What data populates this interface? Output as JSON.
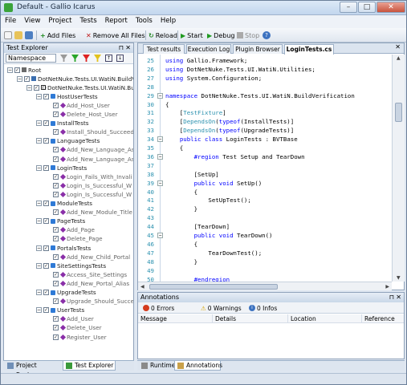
{
  "window": {
    "title": "Default - Gallio Icarus",
    "minimize": "–",
    "maximize": "□",
    "close": "✕"
  },
  "menu": [
    "File",
    "View",
    "Project",
    "Tests",
    "Report",
    "Tools",
    "Help"
  ],
  "toolbar": {
    "add_files": "Add Files",
    "remove_all_files": "Remove All Files",
    "reload": "Reload",
    "start": "Start",
    "debug": "Debug",
    "stop": "Stop"
  },
  "left_panel": {
    "title": "Test Explorer",
    "filter_value": "Namespace",
    "tree": [
      {
        "label": "Root",
        "kind": "root",
        "depth": 0
      },
      {
        "label": "DotNetNuke.Tests.UI.WatiN.BuildV",
        "kind": "asm",
        "depth": 1
      },
      {
        "label": "DotNetNuke.Tests.UI.WatiN.Buil",
        "kind": "ns",
        "depth": 2
      },
      {
        "label": "HostUserTests",
        "kind": "fix",
        "depth": 3
      },
      {
        "label": "Add_Host_User",
        "kind": "test",
        "depth": 4
      },
      {
        "label": "Delete_Host_User",
        "kind": "test",
        "depth": 4
      },
      {
        "label": "InstallTests",
        "kind": "fix",
        "depth": 3
      },
      {
        "label": "Install_Should_Succeed",
        "kind": "test",
        "depth": 4
      },
      {
        "label": "LanguageTests",
        "kind": "fix",
        "depth": 3
      },
      {
        "label": "Add_New_Language_As",
        "kind": "test",
        "depth": 4
      },
      {
        "label": "Add_New_Language_As",
        "kind": "test",
        "depth": 4
      },
      {
        "label": "LoginTests",
        "kind": "fix",
        "depth": 3
      },
      {
        "label": "Login_Fails_With_Invali",
        "kind": "test",
        "depth": 4
      },
      {
        "label": "Login_Is_Successful_W",
        "kind": "test",
        "depth": 4
      },
      {
        "label": "Login_Is_Successful_W",
        "kind": "test",
        "depth": 4
      },
      {
        "label": "ModuleTests",
        "kind": "fix",
        "depth": 3
      },
      {
        "label": "Add_New_Module_Title",
        "kind": "test",
        "depth": 4
      },
      {
        "label": "PageTests",
        "kind": "fix",
        "depth": 3
      },
      {
        "label": "Add_Page",
        "kind": "test",
        "depth": 4
      },
      {
        "label": "Delete_Page",
        "kind": "test",
        "depth": 4
      },
      {
        "label": "PortalsTests",
        "kind": "fix",
        "depth": 3
      },
      {
        "label": "Add_New_Child_Portal",
        "kind": "test",
        "depth": 4
      },
      {
        "label": "SiteSettingsTests",
        "kind": "fix",
        "depth": 3
      },
      {
        "label": "Access_Site_Settings",
        "kind": "test",
        "depth": 4
      },
      {
        "label": "Add_New_Portal_Alias",
        "kind": "test",
        "depth": 4
      },
      {
        "label": "UpgradeTests",
        "kind": "fix",
        "depth": 3
      },
      {
        "label": "Upgrade_Should_Succe",
        "kind": "test",
        "depth": 4
      },
      {
        "label": "UserTests",
        "kind": "fix",
        "depth": 3
      },
      {
        "label": "Add_User",
        "kind": "test",
        "depth": 4
      },
      {
        "label": "Delete_User",
        "kind": "test",
        "depth": 4
      },
      {
        "label": "Register_User",
        "kind": "test",
        "depth": 4
      }
    ],
    "bottom_tabs": [
      "Project Explorer",
      "Test Explorer"
    ]
  },
  "editor": {
    "tabs": [
      "Test results",
      "Execution Log",
      "Plugin Browser",
      "LoginTests.cs"
    ],
    "close": "✕",
    "lines": [
      {
        "n": "25",
        "segs": [
          {
            "t": "using ",
            "c": "kw"
          },
          {
            "t": "Gallio.Framework;",
            "c": ""
          }
        ]
      },
      {
        "n": "26",
        "segs": [
          {
            "t": "using ",
            "c": "kw"
          },
          {
            "t": "DotNetNuke.Tests.UI.WatiN.Utilities;",
            "c": ""
          }
        ]
      },
      {
        "n": "27",
        "segs": [
          {
            "t": "using ",
            "c": "kw"
          },
          {
            "t": "System.Configuration;",
            "c": ""
          }
        ]
      },
      {
        "n": "28",
        "segs": []
      },
      {
        "n": "29",
        "segs": [
          {
            "t": "namespace ",
            "c": "kw"
          },
          {
            "t": "DotNetNuke.Tests.UI.WatiN.BuildVerification",
            "c": ""
          }
        ]
      },
      {
        "n": "30",
        "segs": [
          {
            "t": "{",
            "c": ""
          }
        ]
      },
      {
        "n": "31",
        "segs": [
          {
            "t": "    [",
            "c": ""
          },
          {
            "t": "TestFixture",
            "c": "ty"
          },
          {
            "t": "]",
            "c": ""
          }
        ]
      },
      {
        "n": "32",
        "segs": [
          {
            "t": "    [",
            "c": ""
          },
          {
            "t": "DependsOn",
            "c": "ty"
          },
          {
            "t": "(",
            "c": ""
          },
          {
            "t": "typeof",
            "c": "kw"
          },
          {
            "t": "(InstallTests)]",
            "c": ""
          }
        ]
      },
      {
        "n": "33",
        "segs": [
          {
            "t": "    [",
            "c": ""
          },
          {
            "t": "DependsOn",
            "c": "ty"
          },
          {
            "t": "(",
            "c": ""
          },
          {
            "t": "typeof",
            "c": "kw"
          },
          {
            "t": "(UpgradeTests)]",
            "c": ""
          }
        ]
      },
      {
        "n": "34",
        "segs": [
          {
            "t": "    ",
            "c": ""
          },
          {
            "t": "public class ",
            "c": "kw"
          },
          {
            "t": "LoginTests : BVTBase",
            "c": ""
          }
        ]
      },
      {
        "n": "35",
        "segs": [
          {
            "t": "    {",
            "c": ""
          }
        ]
      },
      {
        "n": "36",
        "segs": [
          {
            "t": "        ",
            "c": ""
          },
          {
            "t": "#region ",
            "c": "kw"
          },
          {
            "t": "Test Setup and TearDown",
            "c": ""
          }
        ]
      },
      {
        "n": "37",
        "segs": []
      },
      {
        "n": "38",
        "segs": [
          {
            "t": "        [SetUp]",
            "c": ""
          }
        ]
      },
      {
        "n": "39",
        "segs": [
          {
            "t": "        ",
            "c": ""
          },
          {
            "t": "public void ",
            "c": "kw"
          },
          {
            "t": "SetUp()",
            "c": ""
          }
        ]
      },
      {
        "n": "40",
        "segs": [
          {
            "t": "        {",
            "c": ""
          }
        ]
      },
      {
        "n": "41",
        "segs": [
          {
            "t": "            SetUpTest();",
            "c": ""
          }
        ]
      },
      {
        "n": "42",
        "segs": [
          {
            "t": "        }",
            "c": ""
          }
        ]
      },
      {
        "n": "43",
        "segs": []
      },
      {
        "n": "44",
        "segs": [
          {
            "t": "        [TearDown]",
            "c": ""
          }
        ]
      },
      {
        "n": "45",
        "segs": [
          {
            "t": "        ",
            "c": ""
          },
          {
            "t": "public void ",
            "c": "kw"
          },
          {
            "t": "TearDown()",
            "c": ""
          }
        ]
      },
      {
        "n": "46",
        "segs": [
          {
            "t": "        {",
            "c": ""
          }
        ]
      },
      {
        "n": "47",
        "segs": [
          {
            "t": "            TearDownTest();",
            "c": ""
          }
        ]
      },
      {
        "n": "48",
        "segs": [
          {
            "t": "        }",
            "c": ""
          }
        ]
      },
      {
        "n": "49",
        "segs": []
      },
      {
        "n": "50",
        "segs": [
          {
            "t": "        ",
            "c": ""
          },
          {
            "t": "#endregion",
            "c": "kw"
          }
        ]
      }
    ]
  },
  "annotations": {
    "title": "Annotations",
    "errors": "0 Errors",
    "warnings": "0 Warnings",
    "infos": "0 Infos",
    "columns": [
      "Message",
      "Details",
      "Location",
      "Reference"
    ]
  },
  "bottom_tabs_right": [
    "Runtime",
    "Annotations"
  ],
  "colors": {
    "keyword": "#0000ff",
    "type": "#2b91af",
    "accent": "#3aa33a"
  }
}
